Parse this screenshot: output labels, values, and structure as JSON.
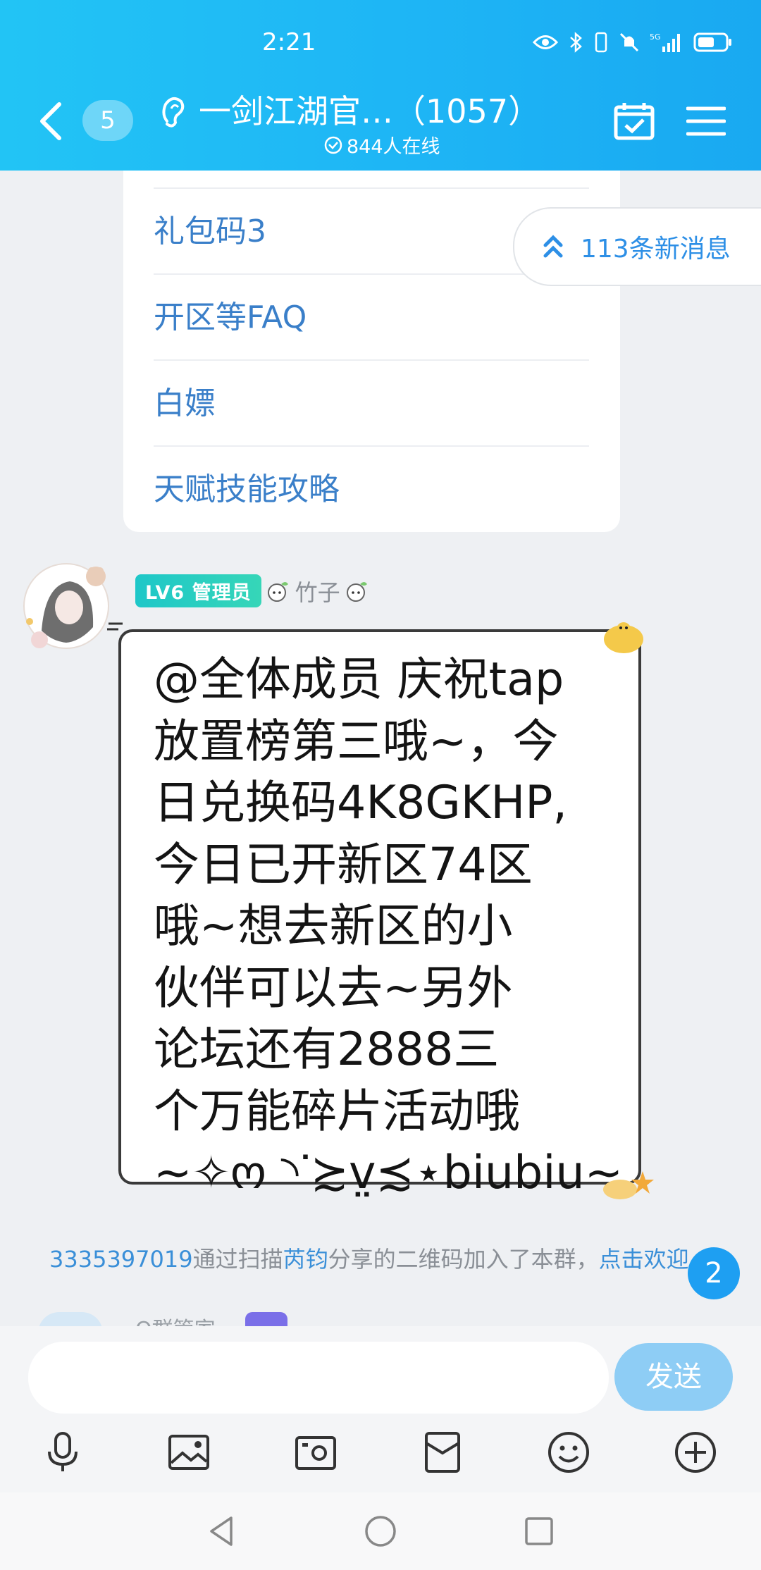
{
  "status": {
    "time": "2:21"
  },
  "header": {
    "unread_count": "5",
    "title": "一剑江湖官…（1057）",
    "online": "844人在线"
  },
  "menu_card": {
    "items": [
      "礼包码3",
      "开区等FAQ",
      "白嫖",
      "天赋技能攻略"
    ]
  },
  "new_messages": "113条新消息",
  "message": {
    "badge": "LV6 管理员",
    "sender": "竹子",
    "text": "@全体成员 庆祝tap\n放置榜第三哦~，今\n日兑换码4K8GKHP,\n今日已开新区74区\n哦~想去新区的小\n伙伴可以去~另外\n论坛还有2888三\n个万能碎片活动哦\n~✧ო ◝ᐝ≿v̤≾⋆biubiu~"
  },
  "system_message": {
    "user_id": "3335397019",
    "part1": "通过扫描",
    "inviter": "芮钧",
    "part2": "分享的二维码加入了本群，",
    "action": "点击欢迎"
  },
  "float_badge": "2",
  "peek_sender": "Q群管家",
  "input": {
    "send_label": "发送"
  },
  "icons": {
    "toolbar": [
      "microphone-icon",
      "image-icon",
      "camera-icon",
      "red-packet-icon",
      "emoji-icon",
      "plus-icon"
    ],
    "nav": [
      "back-triangle-icon",
      "home-circle-icon",
      "recents-square-icon"
    ]
  }
}
